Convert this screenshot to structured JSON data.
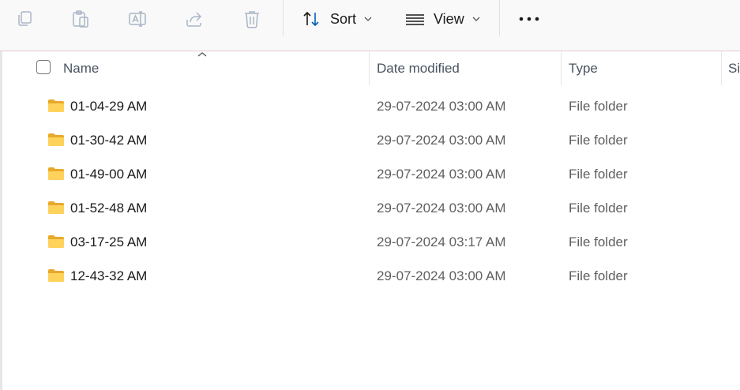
{
  "toolbar": {
    "copy_icon": "copy-icon",
    "paste_icon": "paste-icon",
    "rename_icon": "rename-icon",
    "share_icon": "share-icon",
    "delete_icon": "delete-icon",
    "sort_label": "Sort",
    "view_label": "View",
    "more_icon": "more-options-icon"
  },
  "columns": {
    "name": "Name",
    "date_modified": "Date modified",
    "type": "Type",
    "size": "Si"
  },
  "files": [
    {
      "name": "01-04-29 AM",
      "date": "29-07-2024 03:00 AM",
      "type": "File folder"
    },
    {
      "name": "01-30-42 AM",
      "date": "29-07-2024 03:00 AM",
      "type": "File folder"
    },
    {
      "name": "01-49-00 AM",
      "date": "29-07-2024 03:00 AM",
      "type": "File folder"
    },
    {
      "name": "01-52-48 AM",
      "date": "29-07-2024 03:00 AM",
      "type": "File folder"
    },
    {
      "name": "03-17-25 AM",
      "date": "29-07-2024 03:17 AM",
      "type": "File folder"
    },
    {
      "name": "12-43-32 AM",
      "date": "29-07-2024 03:00 AM",
      "type": "File folder"
    }
  ],
  "colors": {
    "folder": "#f8c63d",
    "accent": "#005fb8",
    "toolbar_bg": "#f9f9f9"
  }
}
